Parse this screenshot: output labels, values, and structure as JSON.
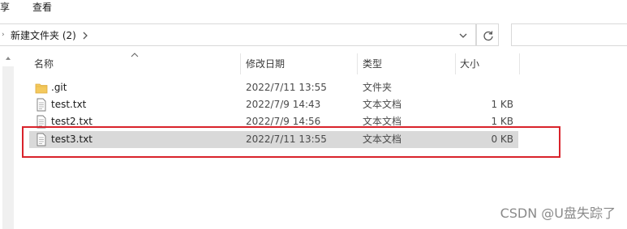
{
  "ribbon": {
    "tabs": [
      {
        "label": "享"
      },
      {
        "label": "查看"
      }
    ]
  },
  "address_bar": {
    "path_label": "新建文件夹 (2)",
    "search_placeholder": ""
  },
  "columns": {
    "name": "名称",
    "date": "修改日期",
    "type": "类型",
    "size": "大小"
  },
  "files": [
    {
      "name": ".git",
      "date": "2022/7/11 13:55",
      "type": "文件夹",
      "size": "",
      "icon": "folder-icon",
      "selected": false
    },
    {
      "name": "test.txt",
      "date": "2022/7/9 14:43",
      "type": "文本文档",
      "size": "1 KB",
      "icon": "text-file-icon",
      "selected": false
    },
    {
      "name": "test2.txt",
      "date": "2022/7/9 14:56",
      "type": "文本文档",
      "size": "1 KB",
      "icon": "text-file-icon",
      "selected": false
    },
    {
      "name": "test3.txt",
      "date": "2022/7/11 13:55",
      "type": "文本文档",
      "size": "0 KB",
      "icon": "text-file-icon",
      "selected": true
    }
  ],
  "watermark": {
    "text": "CSDN @U盘失踪了"
  },
  "colors": {
    "selection": "#d9d9d9",
    "annotation_border": "#d9232b",
    "folder": "#f4c95d"
  }
}
